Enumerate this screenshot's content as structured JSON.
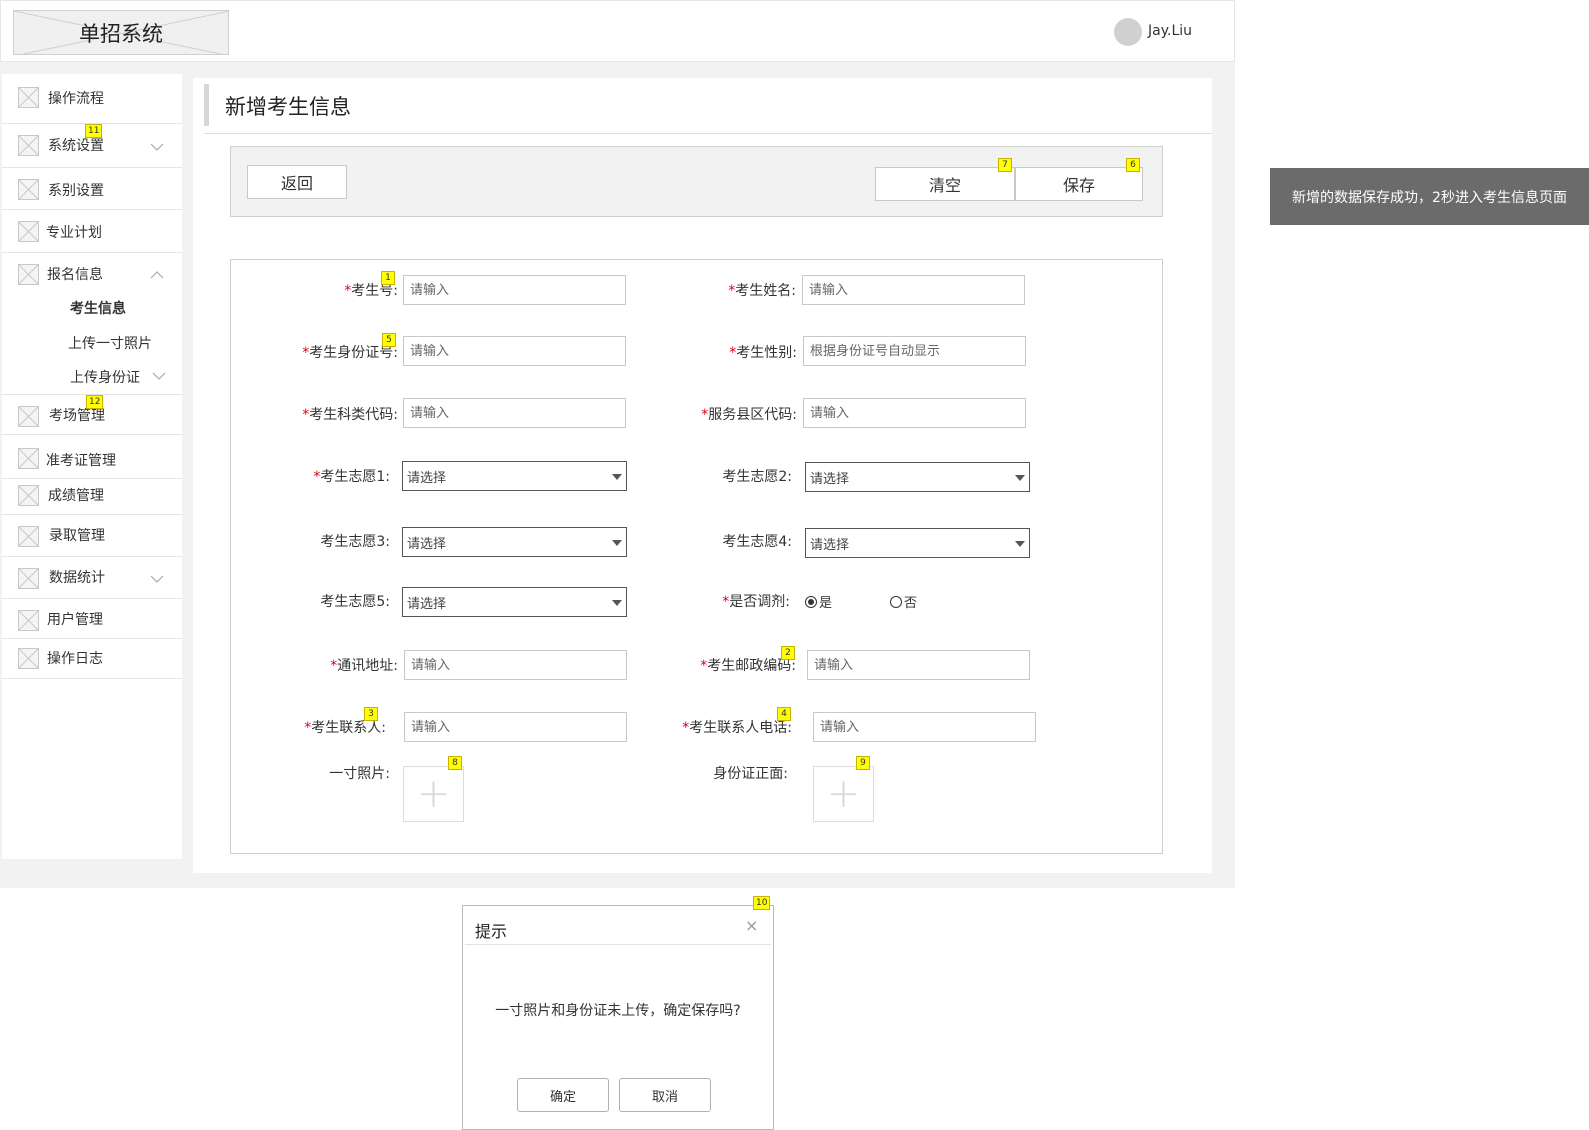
{
  "header": {
    "system_title": "单招系统",
    "user_name": "Jay.Liu"
  },
  "sidebar": {
    "items": [
      {
        "label": "操作流程"
      },
      {
        "label": "系统设置",
        "badge": "11"
      },
      {
        "label": "系别设置"
      },
      {
        "label": "专业计划"
      },
      {
        "label": "报名信息",
        "expanded": true,
        "children": [
          {
            "label": "考生信息",
            "active": true
          },
          {
            "label": "上传一寸照片"
          },
          {
            "label": "上传身份证"
          }
        ]
      },
      {
        "label": "考场管理",
        "badge": "12"
      },
      {
        "label": "准考证管理"
      },
      {
        "label": "成绩管理"
      },
      {
        "label": "录取管理"
      },
      {
        "label": "数据统计"
      },
      {
        "label": "用户管理"
      },
      {
        "label": "操作日志"
      }
    ]
  },
  "page": {
    "title": "新增考生信息"
  },
  "toolbar": {
    "back_label": "返回",
    "clear_label": "清空",
    "clear_badge": "7",
    "save_label": "保存",
    "save_badge": "6"
  },
  "form": {
    "required_mark": "*",
    "placeholder_input": "请输入",
    "placeholder_select": "请选择",
    "exam_no": {
      "label": "考生号:",
      "badge": "1"
    },
    "name": {
      "label": "考生姓名:"
    },
    "id_no": {
      "label": "考生身份证号:",
      "badge": "5"
    },
    "gender": {
      "label": "考生性别:",
      "placeholder": "根据身份证号自动显示"
    },
    "subject_code": {
      "label": "考生科类代码:"
    },
    "county_code": {
      "label": "服务县区代码:"
    },
    "wish1": {
      "label": "考生志愿1:"
    },
    "wish2": {
      "label": "考生志愿2:"
    },
    "wish3": {
      "label": "考生志愿3:"
    },
    "wish4": {
      "label": "考生志愿4:"
    },
    "wish5": {
      "label": "考生志愿5:"
    },
    "adjust": {
      "label": "是否调剂:",
      "option_yes": "是",
      "option_no": "否",
      "selected": "是"
    },
    "address": {
      "label": "通讯地址:"
    },
    "postcode": {
      "label": "考生邮政编码:",
      "badge": "2"
    },
    "contact": {
      "label": "考生联系人:",
      "badge": "3"
    },
    "contact_phone": {
      "label": "考生联系人电话:",
      "badge": "4"
    },
    "photo": {
      "label": "一寸照片:",
      "badge": "8"
    },
    "id_front": {
      "label": "身份证正面:",
      "badge": "9"
    }
  },
  "toast": {
    "message": "新增的数据保存成功，2秒进入考生信息页面"
  },
  "dialog": {
    "title": "提示",
    "badge": "10",
    "close_glyph": "×",
    "message": "一寸照片和身份证未上传，确定保存吗?",
    "confirm_label": "确定",
    "cancel_label": "取消"
  },
  "icons": {
    "upload_glyph": "+"
  }
}
